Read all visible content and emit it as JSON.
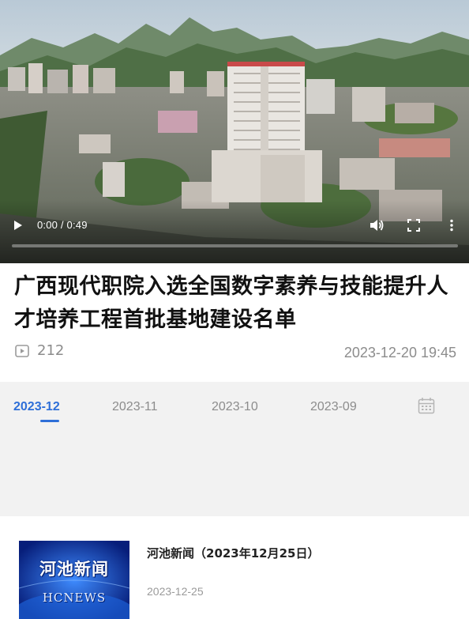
{
  "video": {
    "current_time": "0:00",
    "duration": "0:49",
    "time_display": "0:00 / 0:49",
    "progress_fraction": 0.0
  },
  "article": {
    "title": "广西现代职院入选全国数字素养与技能提升人才培养工程首批基地建设名单",
    "views": "212",
    "date": "2023-12-20 19:45"
  },
  "month_tabs": {
    "items": [
      "2023-12",
      "2023-11",
      "2023-10",
      "2023-09"
    ],
    "active_index": 0
  },
  "news_list": [
    {
      "title": "河池新闻（2023年12月25日）",
      "date": "2023-12-25",
      "thumb_line1": "河池新闻",
      "thumb_line2": "HCNEWS"
    }
  ],
  "colors": {
    "accent": "#2e6fd8",
    "muted_text": "#8c8c8c",
    "tabs_background": "#f2f2f2"
  },
  "icons": [
    "play-icon",
    "volume-icon",
    "fullscreen-icon",
    "more-vertical-icon",
    "video-views-icon",
    "calendar-icon"
  ]
}
